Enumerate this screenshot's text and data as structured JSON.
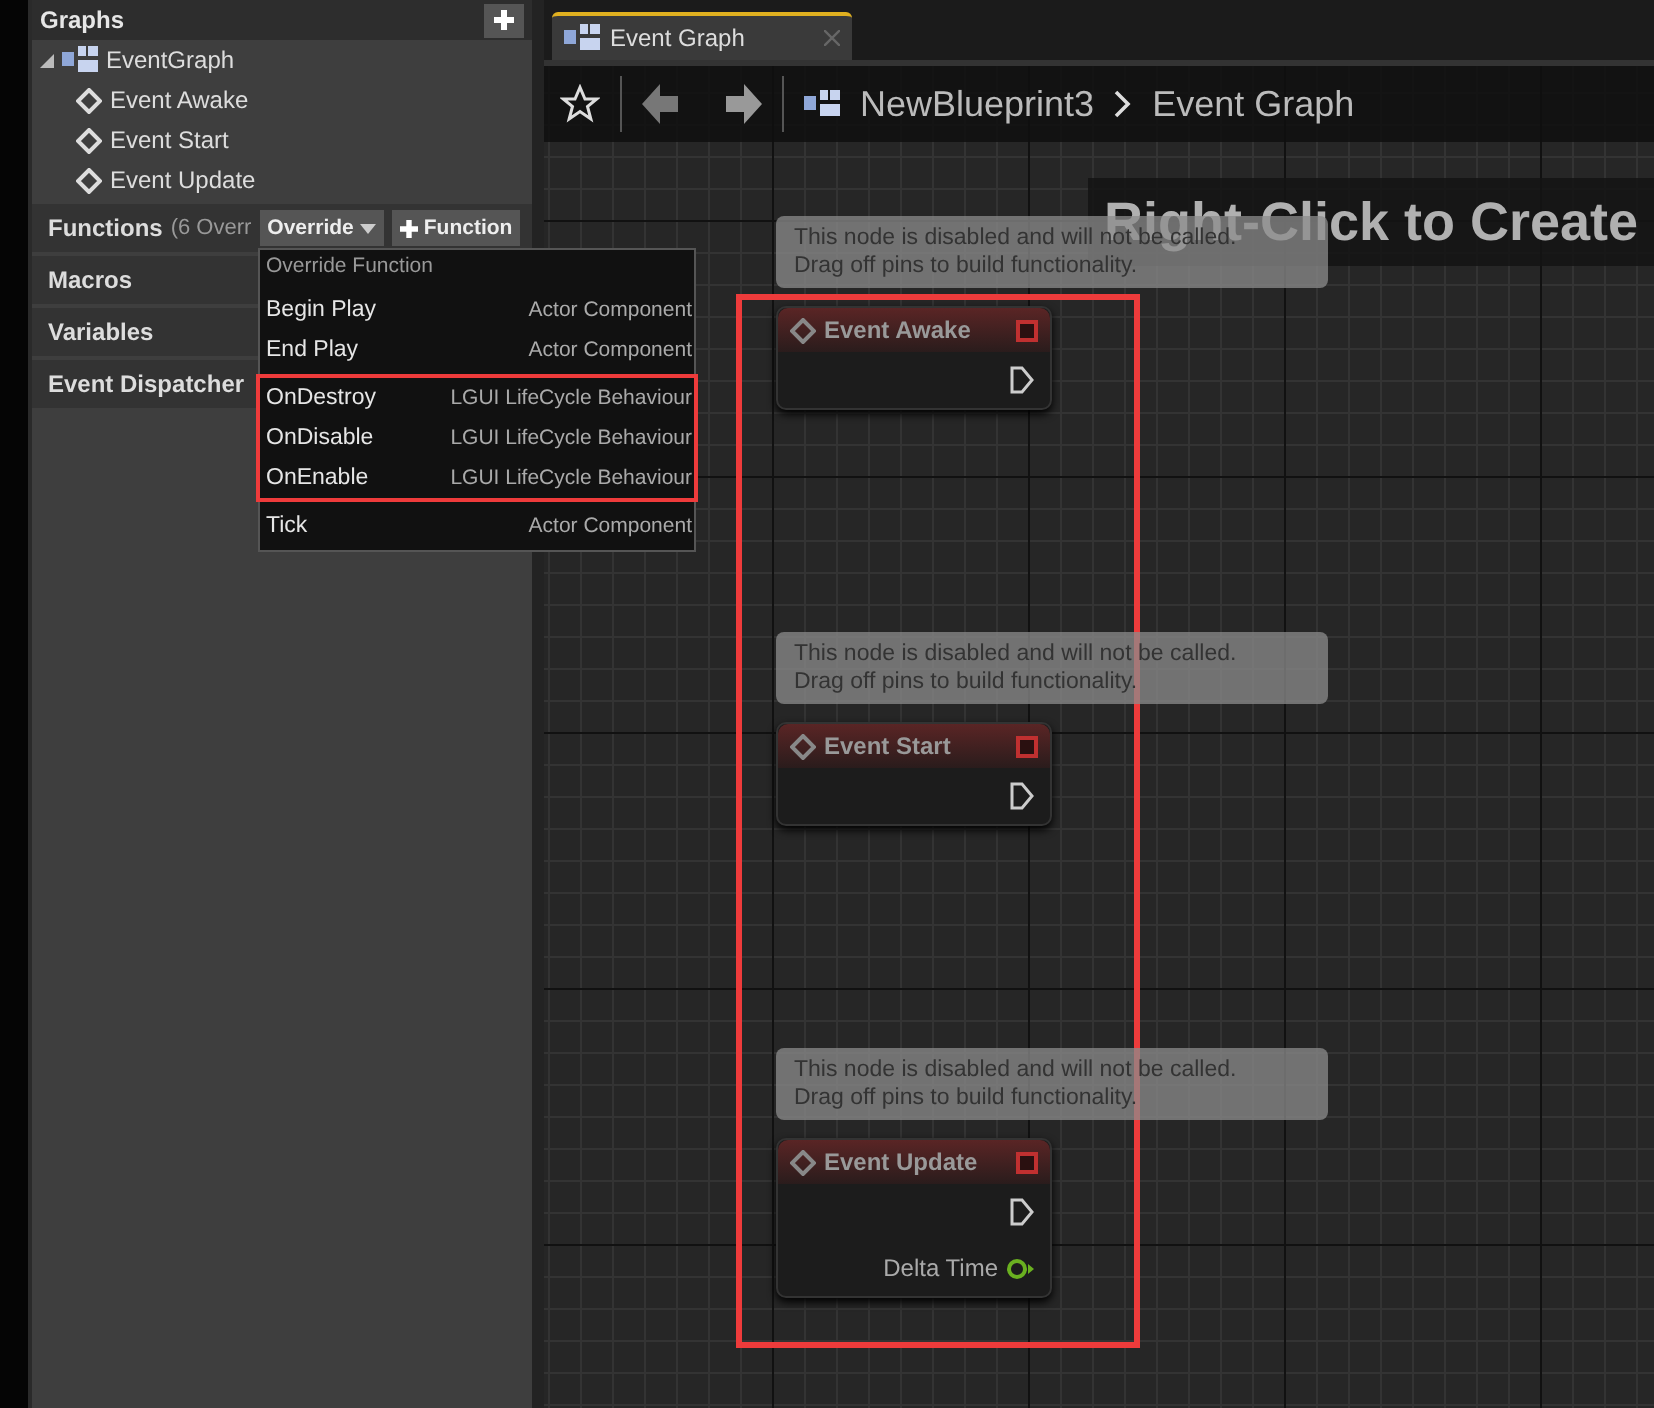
{
  "sidebar": {
    "graphs_header": "Graphs",
    "tree": [
      {
        "label": "EventGraph",
        "expanded": true,
        "children": [
          {
            "label": "Event Awake"
          },
          {
            "label": "Event Start"
          },
          {
            "label": "Event Update"
          }
        ]
      }
    ],
    "sections": [
      {
        "label": "Functions",
        "note": "(6 Overr"
      },
      {
        "label": "Macros"
      },
      {
        "label": "Variables"
      },
      {
        "label": "Event Dispatcher"
      }
    ],
    "override_button": "Override",
    "function_button": "Function"
  },
  "override_menu": {
    "title": "Override Function",
    "items": [
      {
        "name": "Begin Play",
        "source": "Actor Component",
        "highlighted": false
      },
      {
        "name": "End Play",
        "source": "Actor Component",
        "highlighted": false
      },
      {
        "name": "OnDestroy",
        "source": "LGUI LifeCycle Behaviour",
        "highlighted": true
      },
      {
        "name": "OnDisable",
        "source": "LGUI LifeCycle Behaviour",
        "highlighted": true
      },
      {
        "name": "OnEnable",
        "source": "LGUI LifeCycle Behaviour",
        "highlighted": true
      },
      {
        "name": "Tick",
        "source": "Actor Component",
        "highlighted": false
      }
    ]
  },
  "tab": {
    "label": "Event Graph",
    "selected": true
  },
  "breadcrumb": [
    "NewBlueprint3",
    "Event Graph"
  ],
  "graph": {
    "hint": "Right-Click to Create",
    "nodes_highlighted": true,
    "nodes": [
      {
        "comment": "This node is disabled and will not be called.\nDrag off pins to build functionality.",
        "title": "Event Awake"
      },
      {
        "comment": "This node is disabled and will not be called.\nDrag off pins to build functionality.",
        "title": "Event Start"
      },
      {
        "comment": "This node is disabled and will not be called.\nDrag off pins to build functionality.",
        "title": "Event Update",
        "pins": [
          "Delta Time"
        ]
      }
    ]
  }
}
